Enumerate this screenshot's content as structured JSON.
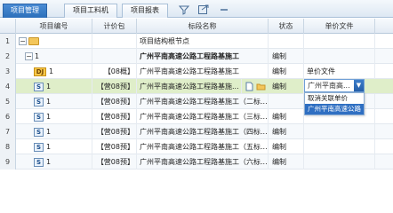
{
  "tabs": [
    {
      "label": "项目管理",
      "active": true
    },
    {
      "label": "项目工料机",
      "active": false
    },
    {
      "label": "项目报表",
      "active": false
    }
  ],
  "columns": {
    "code": "项目编号",
    "package": "计价包",
    "name": "标段名称",
    "status": "状态",
    "unit_file": "单价文件"
  },
  "rows": [
    {
      "num": "1",
      "code": "",
      "package": "",
      "name": "项目结构根节点",
      "status": "",
      "unit_file": ""
    },
    {
      "num": "2",
      "code": "1",
      "package": "",
      "name": "广州平南高速公路工程路基施工",
      "status": "编制",
      "unit_file": ""
    },
    {
      "num": "3",
      "code": "1",
      "badge": "DJ",
      "package": "【08概】",
      "name": "广州平南高速公路工程路基施工",
      "status": "编制",
      "unit_file": "单价文件"
    },
    {
      "num": "4",
      "code": "1",
      "badge": "S",
      "package": "【营08预】",
      "name": "广州平南高速公路工程路基施...",
      "status": "编制",
      "unit_file": "广州平南高..."
    },
    {
      "num": "5",
      "code": "1",
      "badge": "S",
      "package": "【营08预】",
      "name": "广州平南高速公路工程路基施工（二标...",
      "status": "",
      "unit_file": ""
    },
    {
      "num": "6",
      "code": "1",
      "badge": "S",
      "package": "【营08预】",
      "name": "广州平南高速公路工程路基施工（三标...",
      "status": "编制",
      "unit_file": ""
    },
    {
      "num": "7",
      "code": "1",
      "badge": "S",
      "package": "【营08预】",
      "name": "广州平南高速公路工程路基施工（四标...",
      "status": "编制",
      "unit_file": ""
    },
    {
      "num": "8",
      "code": "1",
      "badge": "S",
      "package": "【营08预】",
      "name": "广州平南高速公路工程路基施工（五标...",
      "status": "编制",
      "unit_file": ""
    },
    {
      "num": "9",
      "code": "1",
      "badge": "S",
      "package": "【营08预】",
      "name": "广州平南高速公路工程路基施工（六标...",
      "status": "编制",
      "unit_file": ""
    }
  ],
  "dropdown": {
    "current": "广州平南高...",
    "options": [
      "取消关联单价",
      "广州平南高速公路"
    ],
    "highlighted_index": 1
  },
  "icons": [
    "filter-icon",
    "export-icon",
    "minus-icon",
    "folder-icon",
    "document-icon",
    "dropdown-arrow-icon"
  ]
}
